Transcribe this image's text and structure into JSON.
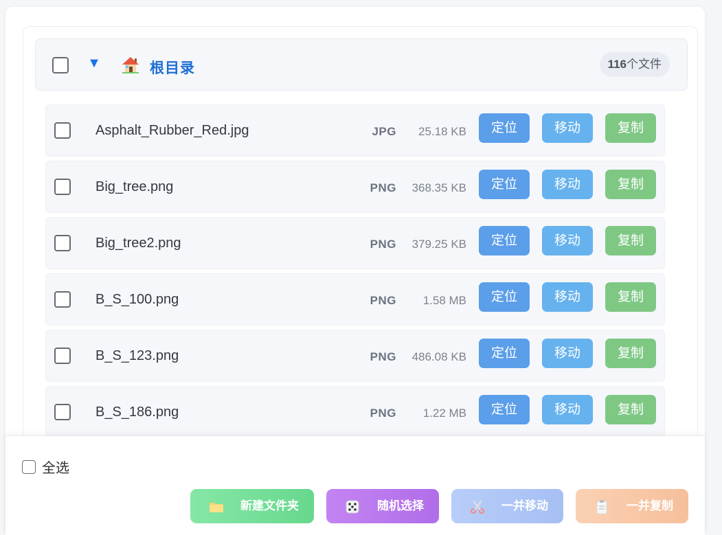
{
  "folder": {
    "title": "根目录",
    "toggle_icon": "▼",
    "icon": "house-icon",
    "count_number": "116",
    "count_suffix": "个文件"
  },
  "row_buttons": {
    "locate": "定位",
    "move": "移动",
    "copy": "复制"
  },
  "files": [
    {
      "name": "Asphalt_Rubber_Red.jpg",
      "type": "JPG",
      "size": "25.18 KB"
    },
    {
      "name": "Big_tree.png",
      "type": "PNG",
      "size": "368.35 KB"
    },
    {
      "name": "Big_tree2.png",
      "type": "PNG",
      "size": "379.25 KB"
    },
    {
      "name": "B_S_100.png",
      "type": "PNG",
      "size": "1.58 MB"
    },
    {
      "name": "B_S_123.png",
      "type": "PNG",
      "size": "486.08 KB"
    },
    {
      "name": "B_S_186.png",
      "type": "PNG",
      "size": "1.22 MB"
    }
  ],
  "bottom": {
    "select_all_label": "全选",
    "new_folder_label": "新建文件夹",
    "random_select_label": "随机选择",
    "batch_move_label": "一并移动",
    "batch_copy_label": "一并复制"
  },
  "colors": {
    "accent_blue": "#1f6fd6",
    "locate_button": "#5b9ee9",
    "move_button": "#66b2ee",
    "copy_button": "#7ec884"
  }
}
